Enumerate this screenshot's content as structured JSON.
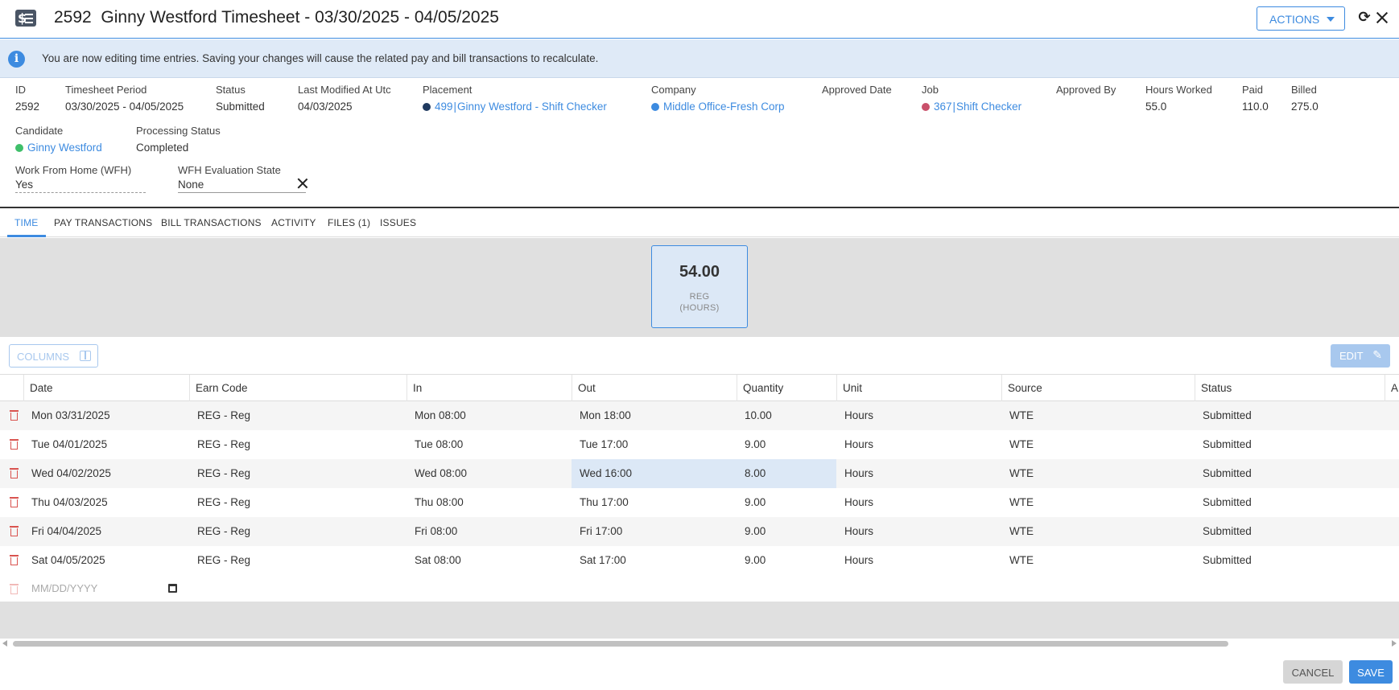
{
  "header": {
    "title": "2592  Ginny Westford Timesheet - 03/30/2025 - 04/05/2025",
    "actions_label": "ACTIONS",
    "app_icon_glyph": "$"
  },
  "banner": {
    "message": "You are now editing time entries. Saving your changes will cause the related pay and bill transactions to recalculate.",
    "info_glyph": "i"
  },
  "details": {
    "id": {
      "label": "ID",
      "value": "2592"
    },
    "period": {
      "label": "Timesheet Period",
      "value": "03/30/2025 - 04/05/2025"
    },
    "status": {
      "label": "Status",
      "value": "Submitted"
    },
    "modified": {
      "label": "Last Modified At Utc",
      "value": "04/03/2025"
    },
    "placement": {
      "label": "Placement",
      "id": "499",
      "name": "Ginny Westford - Shift Checker",
      "dot_color": "#1f3a5f"
    },
    "company": {
      "label": "Company",
      "value": "Middle Office-Fresh Corp",
      "dot_color": "#3d8be0"
    },
    "approved_date": {
      "label": "Approved Date",
      "value": ""
    },
    "job": {
      "label": "Job",
      "id": "367",
      "name": "Shift Checker",
      "dot_color": "#c9506a"
    },
    "approved_by": {
      "label": "Approved By",
      "value": ""
    },
    "hours_worked": {
      "label": "Hours Worked",
      "value": "55.0"
    },
    "paid": {
      "label": "Paid",
      "value": "110.0"
    },
    "billed": {
      "label": "Billed",
      "value": "275.0"
    },
    "candidate": {
      "label": "Candidate",
      "value": "Ginny Westford",
      "dot_color": "#3fbf6a"
    },
    "processing_status": {
      "label": "Processing Status",
      "value": "Completed"
    },
    "wfh": {
      "label": "Work From Home (WFH)",
      "value": "Yes"
    },
    "wfh_state": {
      "label": "WFH Evaluation State",
      "value": "None"
    }
  },
  "tabs": [
    {
      "label": "TIME",
      "active": true
    },
    {
      "label": "PAY TRANSACTIONS"
    },
    {
      "label": "BILL TRANSACTIONS"
    },
    {
      "label": "ACTIVITY"
    },
    {
      "label": "FILES (1)"
    },
    {
      "label": "ISSUES"
    }
  ],
  "summary": {
    "value": "54.00",
    "caption_line1": "REG",
    "caption_line2": "(HOURS)"
  },
  "toolbar": {
    "columns_label": "COLUMNS",
    "edit_label": "EDIT"
  },
  "grid": {
    "columns": [
      "Date",
      "Earn Code",
      "In",
      "Out",
      "Quantity",
      "Unit",
      "Source",
      "Status",
      "A"
    ],
    "rows": [
      {
        "date": "Mon 03/31/2025",
        "earn_code": "REG - Reg",
        "in": "Mon 08:00",
        "out": "Mon 18:00",
        "quantity": "10.00",
        "unit": "Hours",
        "source": "WTE",
        "status": "Submitted"
      },
      {
        "date": "Tue 04/01/2025",
        "earn_code": "REG - Reg",
        "in": "Tue 08:00",
        "out": "Tue 17:00",
        "quantity": "9.00",
        "unit": "Hours",
        "source": "WTE",
        "status": "Submitted"
      },
      {
        "date": "Wed 04/02/2025",
        "earn_code": "REG - Reg",
        "in": "Wed 08:00",
        "out": "Wed 16:00",
        "quantity": "8.00",
        "unit": "Hours",
        "source": "WTE",
        "status": "Submitted"
      },
      {
        "date": "Thu 04/03/2025",
        "earn_code": "REG - Reg",
        "in": "Thu 08:00",
        "out": "Thu 17:00",
        "quantity": "9.00",
        "unit": "Hours",
        "source": "WTE",
        "status": "Submitted"
      },
      {
        "date": "Fri 04/04/2025",
        "earn_code": "REG - Reg",
        "in": "Fri 08:00",
        "out": "Fri 17:00",
        "quantity": "9.00",
        "unit": "Hours",
        "source": "WTE",
        "status": "Submitted"
      },
      {
        "date": "Sat 04/05/2025",
        "earn_code": "REG - Reg",
        "in": "Sat 08:00",
        "out": "Sat 17:00",
        "quantity": "9.00",
        "unit": "Hours",
        "source": "WTE",
        "status": "Submitted"
      }
    ],
    "new_row_placeholder": "MM/DD/YYYY"
  },
  "footer": {
    "cancel_label": "CANCEL",
    "save_label": "SAVE"
  },
  "colors": {
    "accent": "#3d8be0",
    "banner_bg": "#dfeaf7",
    "delete": "#d9534f"
  }
}
